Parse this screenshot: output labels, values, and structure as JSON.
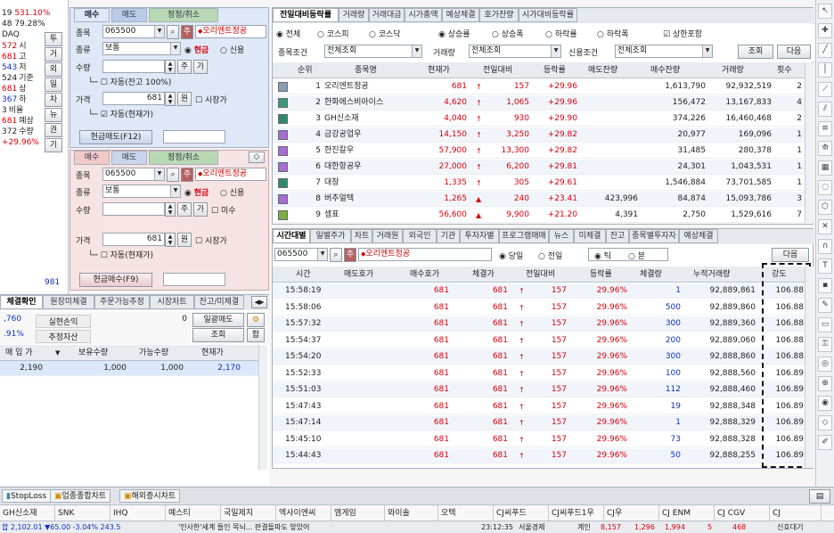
{
  "leftmini": {
    "top1": "19",
    "top1b": "531.10%",
    "top2": "48 79.28%",
    "name": "DAQ",
    "rows": [
      {
        "v": "572",
        "l": "시",
        "cls": "red"
      },
      {
        "v": "681",
        "l": "고",
        "cls": "red"
      },
      {
        "v": "543",
        "l": "저",
        "cls": "blue"
      },
      {
        "v": "524",
        "l": "기준",
        "cls": "k"
      },
      {
        "v": "681",
        "l": "상",
        "cls": "red"
      },
      {
        "v": "367",
        "l": "하",
        "cls": "blue"
      },
      {
        "v": "3",
        "l": "비율",
        "cls": "k"
      },
      {
        "v": "681",
        "l": "예상",
        "cls": "red"
      },
      {
        "v": "372",
        "l": "수량",
        "cls": "k"
      },
      {
        "v": "+29.96%",
        "l": "",
        "cls": "red"
      }
    ],
    "side_buttons": [
      "투",
      "거",
      "외",
      "일",
      "차",
      "뉴",
      "권",
      "기"
    ],
    "bottom_num": "981"
  },
  "order_top": {
    "tabs": [
      "매수",
      "매도",
      "정정/취소"
    ],
    "code_label": "종목",
    "code": "065500",
    "badge": "주",
    "stock_name": "오리엔트정공",
    "type_label": "종류",
    "type_value": "보통",
    "radio_cash": "현금",
    "radio_credit": "신용",
    "qty_label": "수량",
    "qty_btn1": "주",
    "qty_btn2": "가",
    "auto_qty": "자동(잔고 100%)",
    "price_label": "가격",
    "price": "681",
    "unit": "원",
    "market_price": "시장가",
    "auto_price": "자동(현재가)",
    "submit": "현금매도(F12)"
  },
  "order_bottom": {
    "tabs": [
      "매수",
      "매도",
      "정정/취소"
    ],
    "code_label": "종목",
    "code": "065500",
    "badge": "주",
    "stock_name": "오리엔트정공",
    "type_label": "종류",
    "type_value": "보통",
    "radio_cash": "현금",
    "radio_credit": "신용",
    "qty_label": "수량",
    "qty_btn1": "주",
    "qty_btn2": "가",
    "qty_chk": "미수",
    "price_label": "가격",
    "price": "681",
    "unit": "원",
    "market_price": "시장가",
    "auto_price": "자동(현재가)",
    "submit": "현금매수(F9)"
  },
  "balance": {
    "tabs": [
      "체결확인",
      "원장미체결",
      "주문가능추정",
      "시장차트",
      "잔고/미체결"
    ],
    "left1": ",760",
    "left2": ".91%",
    "realized_label": "실현손익",
    "realized_value": "0",
    "sell_all": "일괄매도",
    "est_assets": "추정자산",
    "inquiry": "조회",
    "sum": "합",
    "headers": [
      "매 입 가",
      "보유수량",
      "가능수량",
      "현재가"
    ],
    "row": {
      "buy": "2,190",
      "hold": "1,000",
      "avail": "1,000",
      "cur": "2,170"
    }
  },
  "ranking": {
    "tabs": [
      "전일대비등락률",
      "거래량",
      "거래대금",
      "시가총액",
      "예상체결",
      "호가잔량",
      "시가대비등락률"
    ],
    "market_opts": [
      "전체",
      "코스피",
      "코스닥"
    ],
    "dir_opts": [
      "상승률",
      "상승폭",
      "하락률",
      "하락폭"
    ],
    "limit_chk": "상한포함",
    "cond_label": "종목조건",
    "cond_value": "전체조회",
    "vol_label": "거래량",
    "vol_value": "전체조회",
    "credit_label": "신용조건",
    "credit_value": "전체조회",
    "btn_inquiry": "조회",
    "btn_next": "다음",
    "headers": [
      "순위",
      "종목명",
      "현재가",
      "전일대비",
      "등락률",
      "매도잔량",
      "매수잔량",
      "거래량",
      "횟수"
    ],
    "rows": [
      {
        "rank": "1",
        "name": "오리엔트정공",
        "price": "681",
        "diff": "157",
        "rate": "+29.96",
        "ask": "",
        "bid": "1,613,790",
        "vol": "92,932,519",
        "cnt": "2",
        "icon": "#8aa0b0",
        "up": "↑"
      },
      {
        "rank": "2",
        "name": "한화에스비아이스",
        "price": "4,620",
        "diff": "1,065",
        "rate": "+29.96",
        "ask": "",
        "bid": "156,472",
        "vol": "13,167,833",
        "cnt": "4",
        "icon": "#3a9a76",
        "up": "↑"
      },
      {
        "rank": "3",
        "name": "GH신소재",
        "price": "4,040",
        "diff": "930",
        "rate": "+29.90",
        "ask": "",
        "bid": "374,226",
        "vol": "16,460,468",
        "cnt": "2",
        "icon": "#2f8a6c",
        "up": "↑"
      },
      {
        "rank": "4",
        "name": "금강공업우",
        "price": "14,150",
        "diff": "3,250",
        "rate": "+29.82",
        "ask": "",
        "bid": "20,977",
        "vol": "169,096",
        "cnt": "1",
        "icon": "#a66fd0",
        "up": "↑"
      },
      {
        "rank": "5",
        "name": "한진칼우",
        "price": "57,900",
        "diff": "13,300",
        "rate": "+29.82",
        "ask": "",
        "bid": "31,485",
        "vol": "280,378",
        "cnt": "1",
        "icon": "#a66fd0",
        "up": "↑"
      },
      {
        "rank": "6",
        "name": "대한항공우",
        "price": "27,000",
        "diff": "6,200",
        "rate": "+29.81",
        "ask": "",
        "bid": "24,301",
        "vol": "1,043,531",
        "cnt": "1",
        "icon": "#a66fd0",
        "up": "↑"
      },
      {
        "rank": "7",
        "name": "대창",
        "price": "1,335",
        "diff": "305",
        "rate": "+29.61",
        "ask": "",
        "bid": "1,546,884",
        "vol": "73,701,585",
        "cnt": "1",
        "icon": "#2f8a6c",
        "up": "↑"
      },
      {
        "rank": "8",
        "name": "버추얼텍",
        "price": "1,265",
        "diff": "240",
        "rate": "+23.41",
        "ask": "423,996",
        "bid": "84,874",
        "vol": "15,093,786",
        "cnt": "3",
        "icon": "#a66fd0",
        "up": "▲"
      },
      {
        "rank": "9",
        "name": "셈표",
        "price": "56,600",
        "diff": "9,900",
        "rate": "+21.20",
        "ask": "4,391",
        "bid": "2,750",
        "vol": "1,529,616",
        "cnt": "7",
        "icon": "#7ab040",
        "up": "▲"
      }
    ]
  },
  "ticks": {
    "tabs": [
      "시간대별",
      "일별주가",
      "차트",
      "거래원",
      "외국인",
      "기관",
      "투자자별",
      "프로그램매매",
      "뉴스",
      "미체결",
      "잔고",
      "종목별투자자",
      "예상체결"
    ],
    "code": "065500",
    "badge": "주",
    "stock_name": "오리엔트정공",
    "day_opts": [
      "당일",
      "전일"
    ],
    "unit_opts": [
      "틱",
      "분"
    ],
    "btn_next": "다음",
    "headers": [
      "시간",
      "매도호가",
      "매수호가",
      "체결가",
      "전일대비",
      "등락률",
      "체결량",
      "누적거래량",
      "강도"
    ],
    "rows": [
      {
        "t": "15:58:19",
        "ask": "",
        "bid": "681",
        "px": "681",
        "diff": "157",
        "rate": "29.96%",
        "qty": "1",
        "acc": "92,889,861",
        "str": "106.88",
        "qc": "blue"
      },
      {
        "t": "15:58:06",
        "ask": "",
        "bid": "681",
        "px": "681",
        "diff": "157",
        "rate": "29.96%",
        "qty": "500",
        "acc": "92,889,860",
        "str": "106.88",
        "qc": "blue"
      },
      {
        "t": "15:57:32",
        "ask": "",
        "bid": "681",
        "px": "681",
        "diff": "157",
        "rate": "29.96%",
        "qty": "300",
        "acc": "92,889,360",
        "str": "106.88",
        "qc": "blue"
      },
      {
        "t": "15:54:37",
        "ask": "",
        "bid": "681",
        "px": "681",
        "diff": "157",
        "rate": "29.96%",
        "qty": "200",
        "acc": "92,889,060",
        "str": "106.88",
        "qc": "blue"
      },
      {
        "t": "15:54:20",
        "ask": "",
        "bid": "681",
        "px": "681",
        "diff": "157",
        "rate": "29.96%",
        "qty": "300",
        "acc": "92,888,860",
        "str": "106.88",
        "qc": "blue"
      },
      {
        "t": "15:52:33",
        "ask": "",
        "bid": "681",
        "px": "681",
        "diff": "157",
        "rate": "29.96%",
        "qty": "100",
        "acc": "92,888,560",
        "str": "106.89",
        "qc": "blue"
      },
      {
        "t": "15:51:03",
        "ask": "",
        "bid": "681",
        "px": "681",
        "diff": "157",
        "rate": "29.96%",
        "qty": "112",
        "acc": "92,888,460",
        "str": "106.89",
        "qc": "blue"
      },
      {
        "t": "15:47:43",
        "ask": "",
        "bid": "681",
        "px": "681",
        "diff": "157",
        "rate": "29.96%",
        "qty": "19",
        "acc": "92,888,348",
        "str": "106.89",
        "qc": "blue"
      },
      {
        "t": "15:47:14",
        "ask": "",
        "bid": "681",
        "px": "681",
        "diff": "157",
        "rate": "29.96%",
        "qty": "1",
        "acc": "92,888,329",
        "str": "106.89",
        "qc": "blue"
      },
      {
        "t": "15:45:10",
        "ask": "",
        "bid": "681",
        "px": "681",
        "diff": "157",
        "rate": "29.96%",
        "qty": "73",
        "acc": "92,888,328",
        "str": "106.89",
        "qc": "blue"
      },
      {
        "t": "15:44:43",
        "ask": "",
        "bid": "681",
        "px": "681",
        "diff": "157",
        "rate": "29.96%",
        "qty": "50",
        "acc": "92,888,255",
        "str": "106.89",
        "qc": "blue"
      }
    ]
  },
  "bottom_tabs": [
    "StopLoss",
    "업종종합차트",
    "해외증시차트"
  ],
  "ticker": [
    "GH신소재",
    "SNK",
    "IHQ",
    "예스티",
    "국일제지",
    "엑사이엔씨",
    "엠게임",
    "와이솔",
    "오텍",
    "CJ씨푸드",
    "CJ씨푸드1우",
    "CJ우",
    "CJ ENM",
    "CJ CGV",
    "CJ"
  ],
  "statusbar": {
    "left": "합 2,102.01 ▼65.00 -3.04% 243.5",
    "msg": "'인사한'세계 들인 목뇌... 판결돌파도 앞았어",
    "time": "23:12:35",
    "server": "서울경제",
    "account": "계인",
    "count1": "8,157",
    "count2": "1,296",
    "count3": "1,994",
    "count4": "5",
    "count5": "468",
    "login": "신호대기"
  }
}
